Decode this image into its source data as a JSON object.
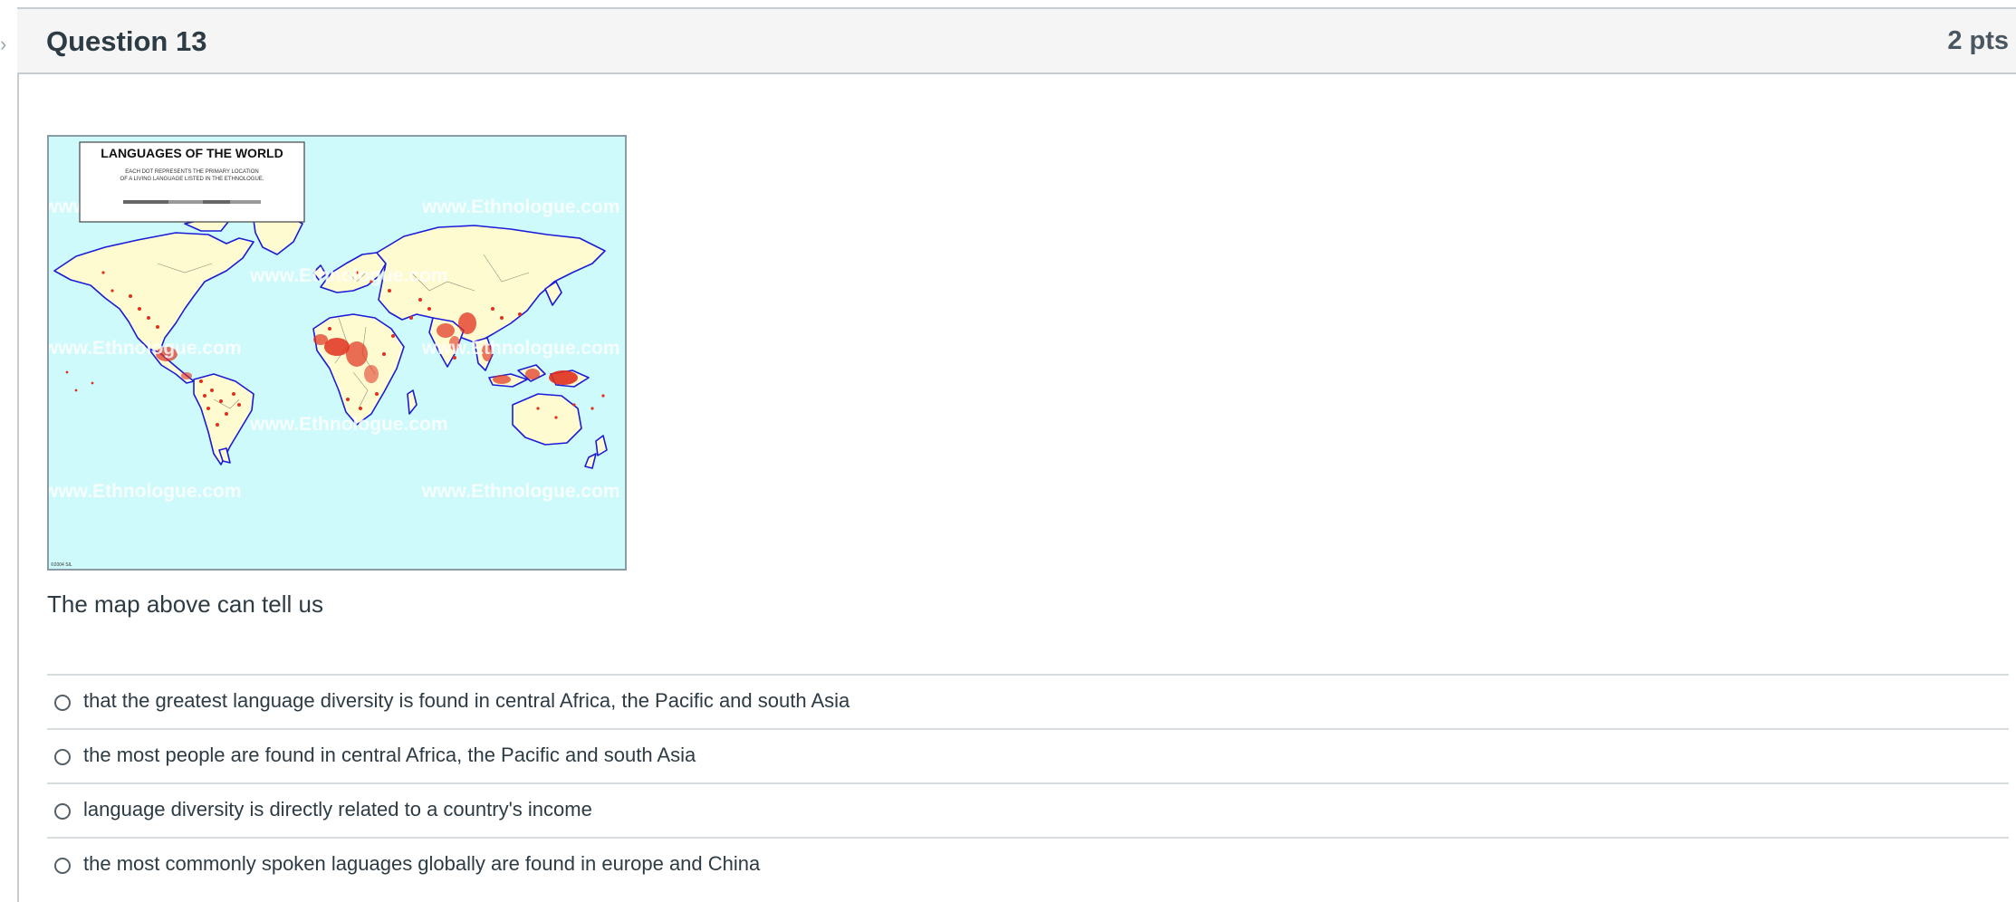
{
  "question": {
    "title": "Question 13",
    "points": "2 pts",
    "prompt": "The map above can tell us"
  },
  "map": {
    "legend_title": "LANGUAGES OF THE WORLD",
    "legend_line1": "EACH DOT REPRESENTS THE PRIMARY LOCATION",
    "legend_line2": "OF A LIVING LANGUAGE LISTED IN THE ETHNOLOGUE.",
    "watermark": "www.Ethnologue.com",
    "copyright": "©2004 SIL",
    "colors": {
      "ocean": "#cffafb",
      "land": "#fffbd0",
      "coast": "#1b1bd8",
      "dots": "#e0301e"
    }
  },
  "answers": [
    {
      "label": "that the greatest language diversity is found in central Africa, the Pacific and south Asia",
      "selected": false
    },
    {
      "label": "the most people are found in central Africa, the Pacific and south Asia",
      "selected": false
    },
    {
      "label": "language diversity is directly related to a country's income",
      "selected": false
    },
    {
      "label": "the most commonly spoken laguages globally are found in europe and China",
      "selected": false
    }
  ]
}
